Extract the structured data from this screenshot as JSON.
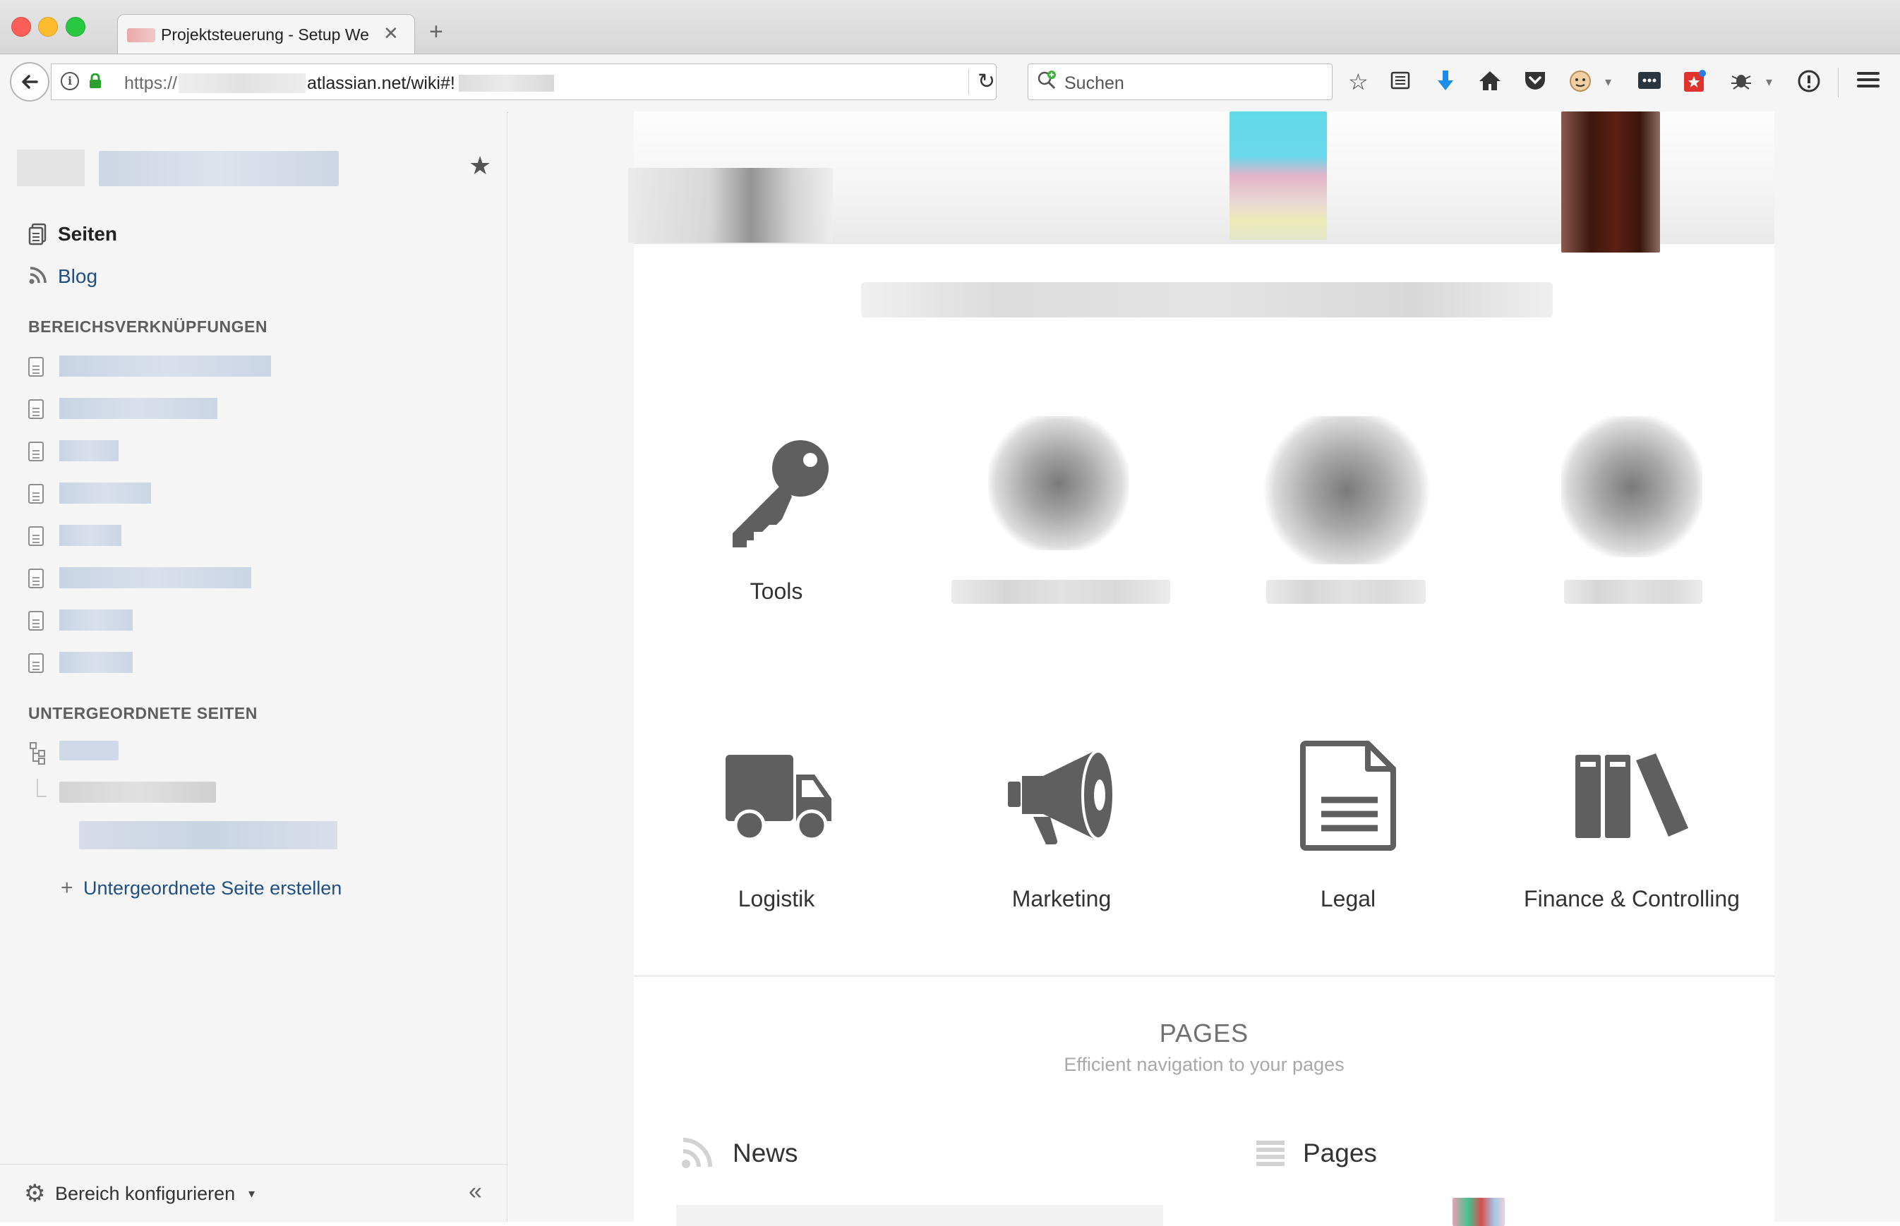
{
  "browser": {
    "tab_title": "Projektsteuerung - Setup We",
    "tab_close": "✕",
    "new_tab": "+",
    "url_proto": "https://",
    "url_host": "atlassian.net/wiki#!",
    "search_placeholder": "Suchen",
    "toolbar_icons": [
      "bookmark-star-icon",
      "reading-list-icon",
      "downloads-icon",
      "home-icon",
      "pocket-icon",
      "avatar-extension-icon",
      "password-manager-icon",
      "red-extension-icon",
      "bug-extension-icon",
      "info-extension-icon",
      "menu-icon"
    ]
  },
  "sidebar": {
    "nav": [
      {
        "label": "Seiten",
        "icon": "pages-icon"
      },
      {
        "label": "Blog",
        "icon": "rss-icon"
      }
    ],
    "links_heading": "BEREICHSVERKNÜPFUNGEN",
    "children_heading": "UNTERGEORDNETE SEITEN",
    "create_child": "Untergeordnete Seite erstellen",
    "create_child_plus": "+",
    "configure": "Bereich konfigurieren",
    "configure_caret": "▾",
    "collapse": "«"
  },
  "main": {
    "tiles": [
      {
        "label": "Tools",
        "icon": "key-icon"
      },
      {
        "label": "Logistik",
        "icon": "truck-icon"
      },
      {
        "label": "Marketing",
        "icon": "megaphone-icon"
      },
      {
        "label": "Legal",
        "icon": "document-icon"
      },
      {
        "label": "Finance & Controlling",
        "icon": "books-icon"
      }
    ],
    "pages_section": {
      "title": "PAGES",
      "subtitle": "Efficient navigation to your pages",
      "news_label": "News",
      "pages_label": "Pages"
    }
  },
  "colors": {
    "link": "#205081",
    "icon_gray": "#5f5f5f",
    "sidebar_bg": "#f5f5f5"
  }
}
